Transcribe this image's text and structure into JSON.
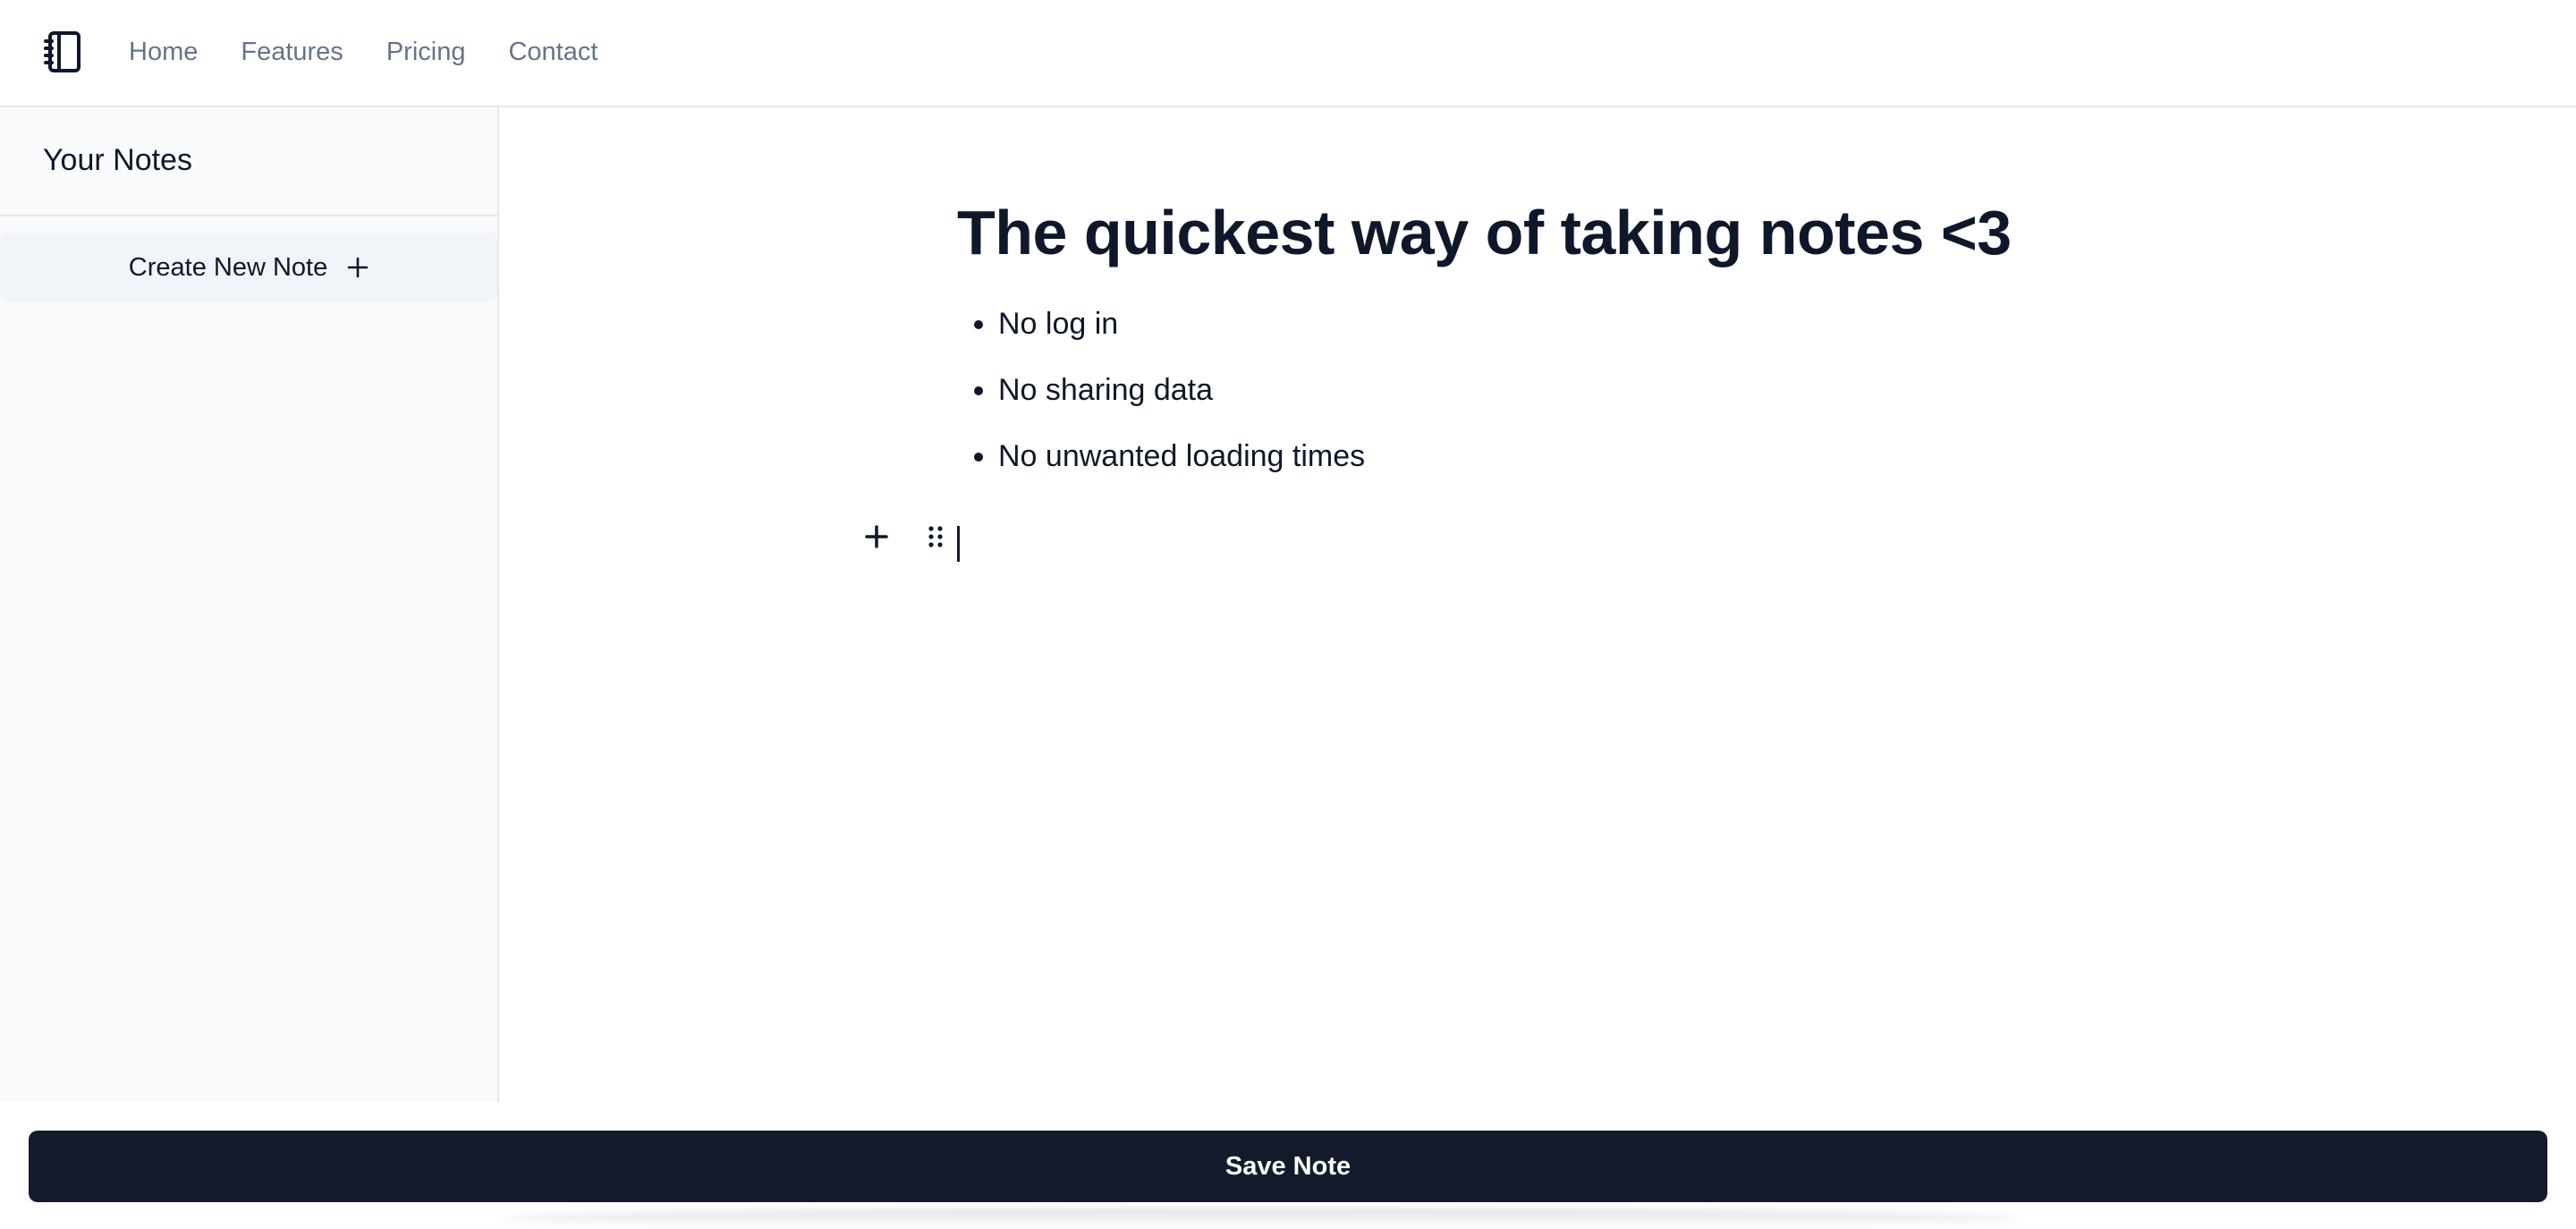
{
  "nav": {
    "logo_icon": "notebook-icon",
    "links": [
      {
        "label": "Home"
      },
      {
        "label": "Features"
      },
      {
        "label": "Pricing"
      },
      {
        "label": "Contact"
      }
    ]
  },
  "sidebar": {
    "title": "Your Notes",
    "create_button": {
      "label": "Create New Note",
      "icon": "plus-icon"
    }
  },
  "editor": {
    "heading": "The quickest way of taking notes <3",
    "bullets": [
      "No log in",
      "No sharing data",
      "No unwanted loading times"
    ],
    "block_tools": {
      "add_icon": "plus-icon",
      "drag_icon": "drag-handle-icon"
    }
  },
  "footer": {
    "save_label": "Save Note"
  },
  "colors": {
    "nav_text": "#64748b",
    "sidebar_bg": "#f8fafc",
    "button_bg": "#131a2b",
    "text": "#0f172a"
  }
}
